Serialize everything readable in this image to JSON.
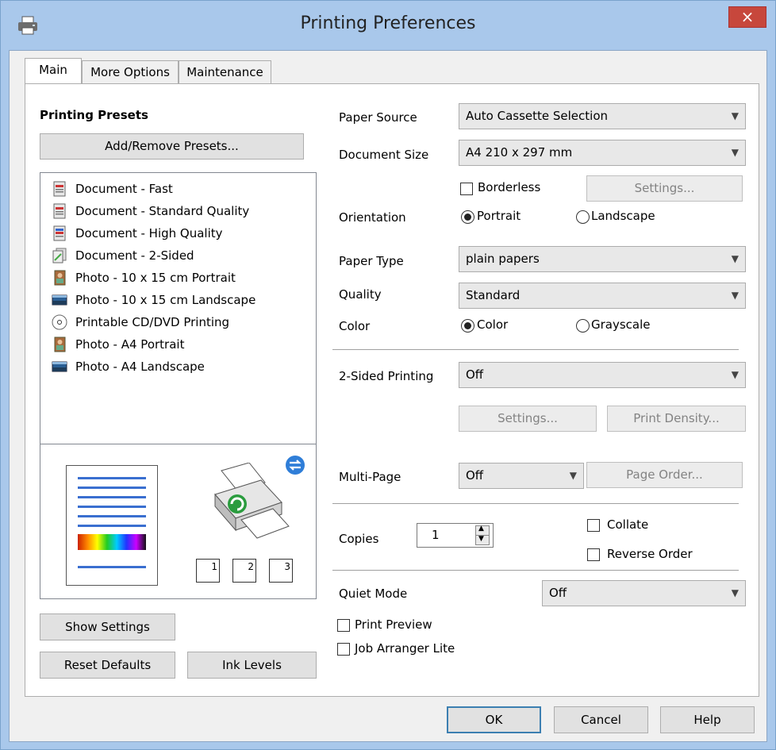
{
  "window": {
    "title": "Printing Preferences",
    "close": "×"
  },
  "tabs": [
    {
      "label": "Main"
    },
    {
      "label": "More Options"
    },
    {
      "label": "Maintenance"
    }
  ],
  "presets": {
    "heading": "Printing Presets",
    "add_remove": "Add/Remove Presets...",
    "items": [
      {
        "label": "Document - Fast"
      },
      {
        "label": "Document - Standard Quality"
      },
      {
        "label": "Document - High Quality"
      },
      {
        "label": "Document - 2-Sided"
      },
      {
        "label": "Photo - 10 x 15 cm Portrait"
      },
      {
        "label": "Photo - 10 x 15 cm Landscape"
      },
      {
        "label": "Printable CD/DVD Printing"
      },
      {
        "label": "Photo - A4 Portrait"
      },
      {
        "label": "Photo - A4 Landscape"
      }
    ]
  },
  "preview": {
    "pages": [
      "1",
      "2",
      "3"
    ]
  },
  "left_buttons": {
    "show_settings": "Show Settings",
    "reset_defaults": "Reset Defaults",
    "ink_levels": "Ink Levels"
  },
  "settings": {
    "paper_source": {
      "label": "Paper Source",
      "value": "Auto Cassette Selection"
    },
    "document_size": {
      "label": "Document Size",
      "value": "A4 210 x 297 mm"
    },
    "borderless": "Borderless",
    "settings_btn": "Settings...",
    "orientation": {
      "label": "Orientation",
      "portrait": "Portrait",
      "landscape": "Landscape"
    },
    "paper_type": {
      "label": "Paper Type",
      "value": "plain papers"
    },
    "quality": {
      "label": "Quality",
      "value": "Standard"
    },
    "color": {
      "label": "Color",
      "color": "Color",
      "grayscale": "Grayscale"
    },
    "two_sided": {
      "label": "2-Sided Printing",
      "value": "Off"
    },
    "settings_btn2": "Settings...",
    "print_density": "Print Density...",
    "multi_page": {
      "label": "Multi-Page",
      "value": "Off"
    },
    "page_order": "Page Order...",
    "copies": {
      "label": "Copies",
      "value": "1"
    },
    "collate": "Collate",
    "reverse_order": "Reverse Order",
    "quiet_mode": {
      "label": "Quiet Mode",
      "value": "Off"
    },
    "print_preview": "Print Preview",
    "job_arranger": "Job Arranger Lite"
  },
  "footer": {
    "ok": "OK",
    "cancel": "Cancel",
    "help": "Help"
  },
  "colors": {
    "accent": "#a9c8eb",
    "close": "#c7473c",
    "focus": "#3c7fb1"
  }
}
